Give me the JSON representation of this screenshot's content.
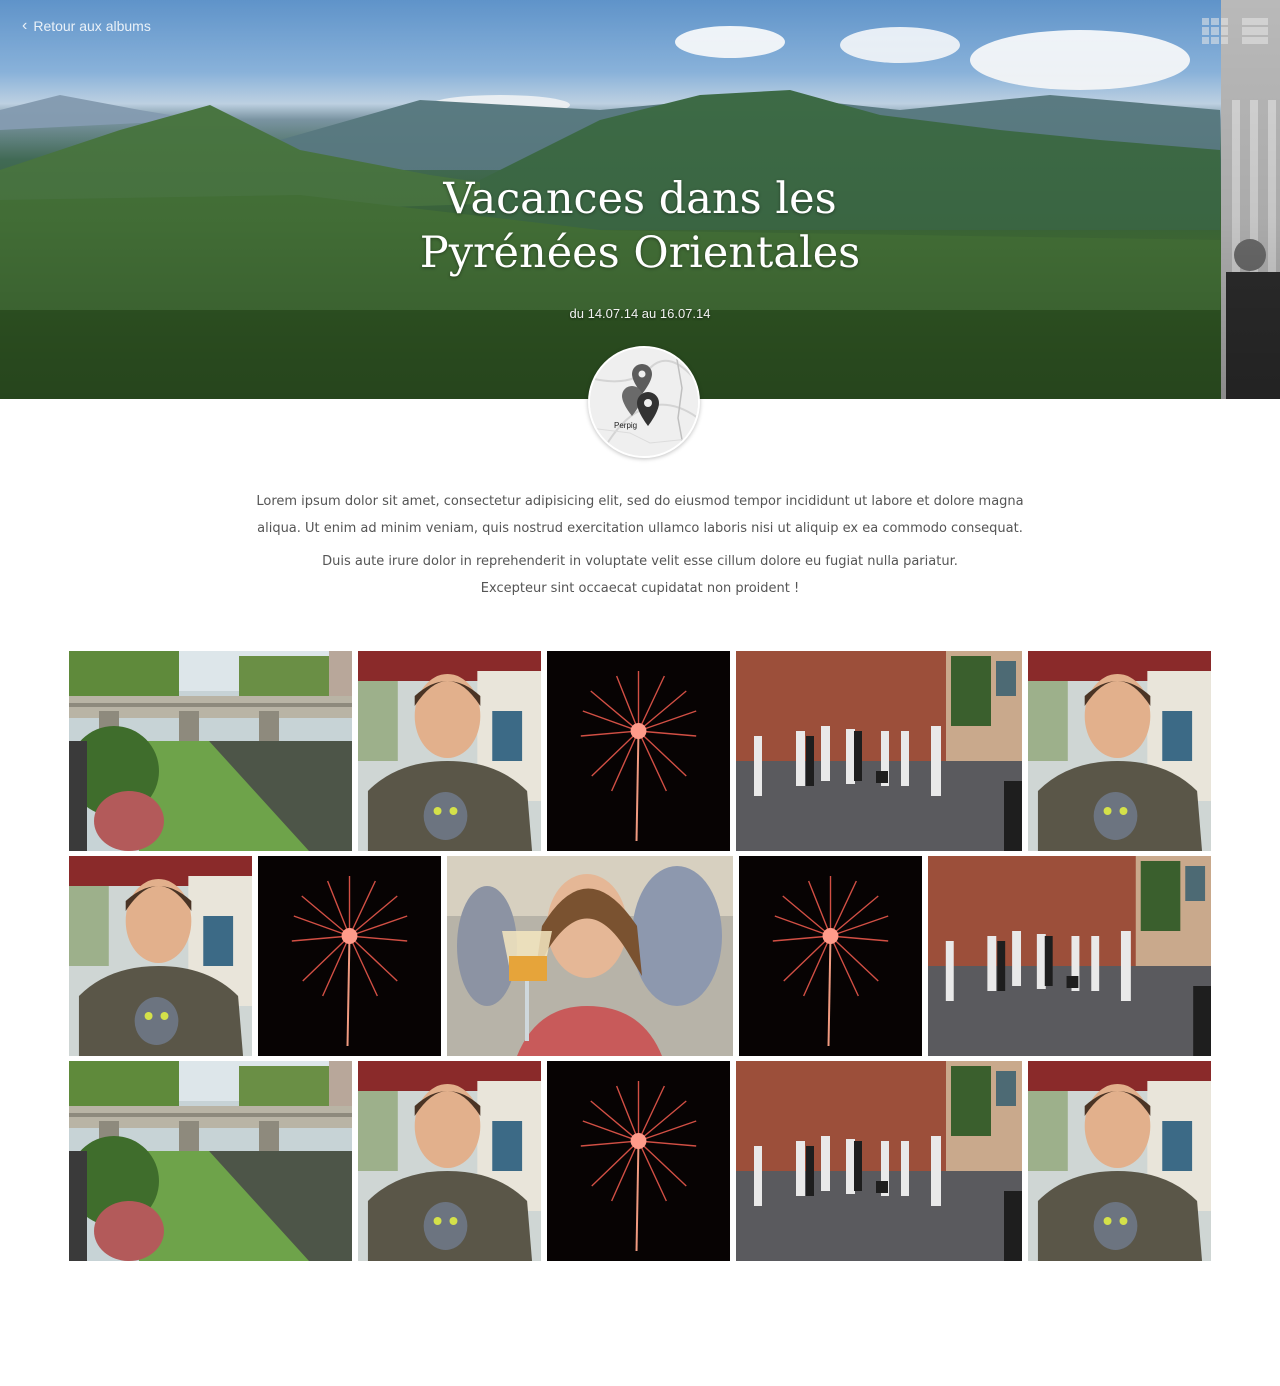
{
  "header": {
    "back_label": "Retour aux albums",
    "title_line1": "Vacances dans les",
    "title_line2": "Pyrénées Orientales",
    "dates": "du 14.07.14 au 16.07.14"
  },
  "map": {
    "place_label": "Perpig"
  },
  "description": {
    "paragraph1": "Lorem ipsum dolor sit amet, consectetur adipisicing elit, sed do eiusmod tempor incididunt ut labore et dolore magna aliqua. Ut enim ad minim veniam, quis nostrud exercitation ullamco laboris nisi ut aliquip ex ea commodo consequat.",
    "paragraph2_line1": "Duis aute irure dolor in reprehenderit in voluptate velit esse cillum dolore eu fugiat nulla pariatur.",
    "paragraph2_line2": "Excepteur sint occaecat cupidatat non proident !"
  },
  "gallery": {
    "rows": [
      [
        "canal-bridge",
        "man-portrait",
        "fireworks",
        "street-dancers",
        "man-portrait"
      ],
      [
        "man-portrait",
        "fireworks",
        "woman-beer",
        "fireworks",
        "street-dancers"
      ],
      [
        "canal-bridge",
        "man-portrait",
        "fireworks",
        "street-dancers",
        "man-portrait"
      ]
    ]
  },
  "icons": {
    "back": "chevron-left-icon",
    "grid_view": "grid-view-icon",
    "list_view": "list-view-icon",
    "map_pin": "map-pin-icon"
  }
}
